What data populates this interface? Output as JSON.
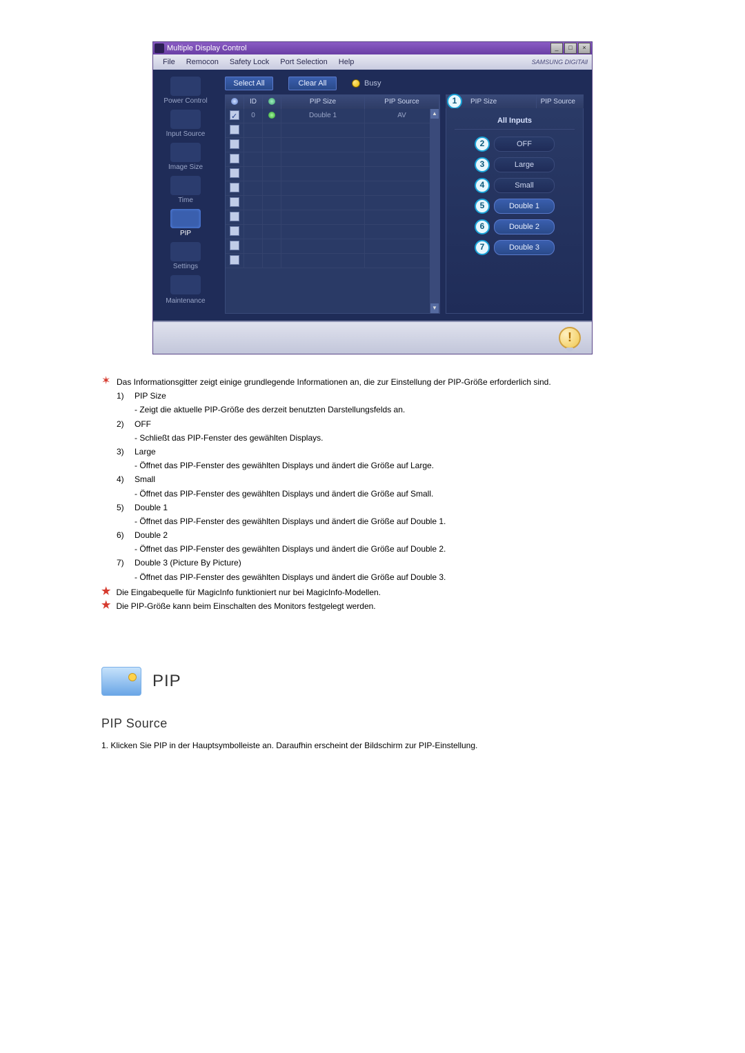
{
  "titlebar": {
    "title": "Multiple Display Control",
    "minimize": "_",
    "maximize": "□",
    "close": "×"
  },
  "menubar": {
    "items": [
      "File",
      "Remocon",
      "Safety Lock",
      "Port Selection",
      "Help"
    ],
    "brand": "SAMSUNG DIGITAll"
  },
  "sidebar": {
    "items": [
      {
        "label": "Power Control"
      },
      {
        "label": "Input Source"
      },
      {
        "label": "Image Size"
      },
      {
        "label": "Time"
      },
      {
        "label": "PIP"
      },
      {
        "label": "Settings"
      },
      {
        "label": "Maintenance"
      }
    ]
  },
  "toolbar": {
    "select_all": "Select All",
    "clear_all": "Clear All",
    "busy_label": "Busy"
  },
  "grid": {
    "headers": {
      "check": "✓",
      "id": "ID",
      "status": "",
      "pipsize": "PIP Size",
      "pipsource": "PIP Source"
    },
    "rows": [
      {
        "checked": true,
        "id": "0",
        "status": "green",
        "pipsize": "Double 1",
        "pipsource": "AV"
      },
      {
        "checked": false,
        "id": "",
        "status": "",
        "pipsize": "",
        "pipsource": ""
      },
      {
        "checked": false,
        "id": "",
        "status": "",
        "pipsize": "",
        "pipsource": ""
      },
      {
        "checked": false,
        "id": "",
        "status": "",
        "pipsize": "",
        "pipsource": ""
      },
      {
        "checked": false,
        "id": "",
        "status": "",
        "pipsize": "",
        "pipsource": ""
      },
      {
        "checked": false,
        "id": "",
        "status": "",
        "pipsize": "",
        "pipsource": ""
      },
      {
        "checked": false,
        "id": "",
        "status": "",
        "pipsize": "",
        "pipsource": ""
      },
      {
        "checked": false,
        "id": "",
        "status": "",
        "pipsize": "",
        "pipsource": ""
      },
      {
        "checked": false,
        "id": "",
        "status": "",
        "pipsize": "",
        "pipsource": ""
      },
      {
        "checked": false,
        "id": "",
        "status": "",
        "pipsize": "",
        "pipsource": ""
      },
      {
        "checked": false,
        "id": "",
        "status": "",
        "pipsize": "",
        "pipsource": ""
      }
    ]
  },
  "panel": {
    "header_left": "PIP Size",
    "header_right": "PIP Source",
    "section_title": "All Inputs",
    "callouts": {
      "c1": "1",
      "c2": "2",
      "c3": "3",
      "c4": "4",
      "c5": "5",
      "c6": "6",
      "c7": "7"
    },
    "options": {
      "b2": "OFF",
      "b3": "Large",
      "b4": "Small",
      "b5": "Double 1",
      "b6": "Double 2",
      "b7": "Double 3"
    }
  },
  "status_strip": {
    "warn": "!"
  },
  "doc": {
    "intro": "Das Informationsgitter zeigt einige grundlegende Informationen an, die zur Einstellung der PIP-Größe erforderlich sind.",
    "items": [
      {
        "num": "1)",
        "label": "PIP Size",
        "text": "- Zeigt die aktuelle PIP-Größe des derzeit benutzten Darstellungsfelds an."
      },
      {
        "num": "2)",
        "label": "OFF",
        "text": "- Schließt das PIP-Fenster des gewählten Displays."
      },
      {
        "num": "3)",
        "label": "Large",
        "text": "- Öffnet das PIP-Fenster des gewählten Displays und ändert die Größe auf Large."
      },
      {
        "num": "4)",
        "label": "Small",
        "text": "- Öffnet das PIP-Fenster des gewählten Displays und ändert die Größe auf Small."
      },
      {
        "num": "5)",
        "label": "Double 1",
        "text": "- Öffnet das PIP-Fenster des gewählten Displays und ändert die Größe auf Double 1."
      },
      {
        "num": "6)",
        "label": "Double 2",
        "text": "- Öffnet das PIP-Fenster des gewählten Displays und ändert die Größe auf Double 2."
      },
      {
        "num": "7)",
        "label": "Double 3 (Picture By Picture)",
        "text": "- Öffnet das PIP-Fenster des gewählten Displays und ändert die Größe auf Double 3."
      }
    ],
    "notes": [
      "Die Eingabequelle für MagicInfo funktioniert nur bei MagicInfo-Modellen.",
      "Die PIP-Größe kann beim Einschalten des Monitors festgelegt werden."
    ],
    "section_heading": "PIP",
    "sub_heading": "PIP Source",
    "instruction": "1. Klicken Sie PIP in der Hauptsymbolleiste an. Daraufhin erscheint der Bildschirm zur PIP-Einstellung."
  }
}
